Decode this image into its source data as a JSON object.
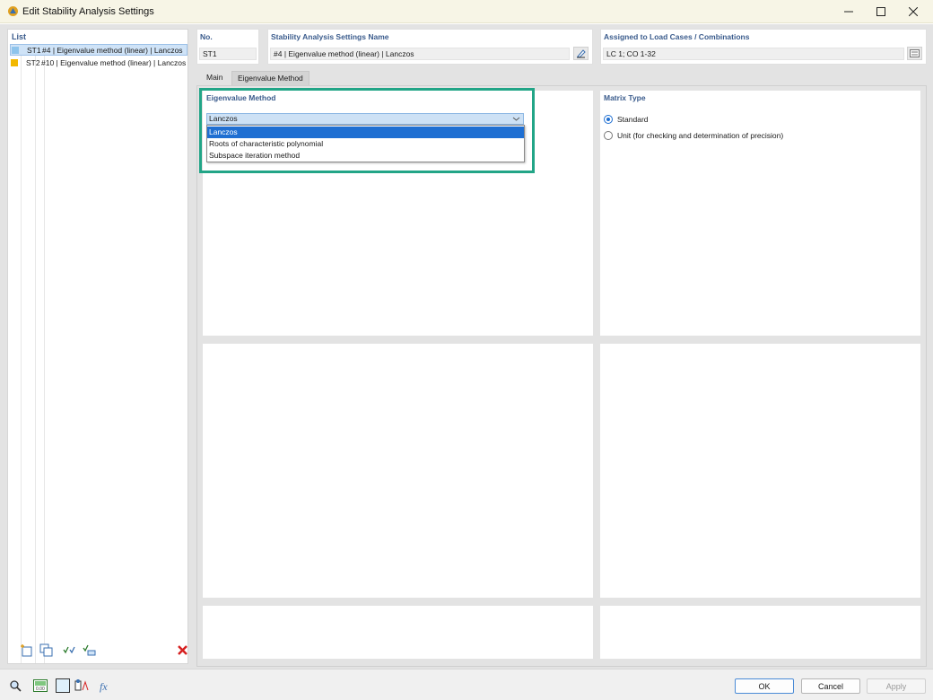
{
  "window": {
    "title": "Edit Stability Analysis Settings",
    "icon": "rfem-app-icon"
  },
  "list": {
    "header": "List",
    "items": [
      {
        "id": "ST1",
        "label": "#4 | Eigenvalue method (linear) | Lanczos",
        "color": "#8ec4ec",
        "selected": true
      },
      {
        "id": "ST2",
        "label": "#10 | Eigenvalue method (linear) | Lanczos",
        "color": "#f2b800",
        "selected": false
      }
    ]
  },
  "fields": {
    "no_label": "No.",
    "no_value": "ST1",
    "name_label": "Stability Analysis Settings Name",
    "name_value": "#4 | Eigenvalue method (linear) | Lanczos",
    "assigned_label": "Assigned to Load Cases / Combinations",
    "assigned_value": "LC 1; CO 1-32"
  },
  "tabs": [
    {
      "label": "Main",
      "active": false
    },
    {
      "label": "Eigenvalue Method",
      "active": true
    }
  ],
  "eigenvalue_method": {
    "header": "Eigenvalue Method",
    "selected": "Lanczos",
    "options": [
      "Lanczos",
      "Roots of characteristic polynomial",
      "Subspace iteration method"
    ],
    "highlighted_option": "Lanczos"
  },
  "matrix_type": {
    "header": "Matrix Type",
    "options": [
      {
        "label": "Standard",
        "selected": true
      },
      {
        "label": "Unit (for checking and determination of precision)",
        "selected": false
      }
    ]
  },
  "buttons": {
    "ok": "OK",
    "cancel": "Cancel",
    "apply": "Apply"
  },
  "colors": {
    "accent": "#1f6fd2",
    "header_text": "#3a5b8c",
    "highlight_frame": "#22a587",
    "delete_red": "#d62020"
  }
}
